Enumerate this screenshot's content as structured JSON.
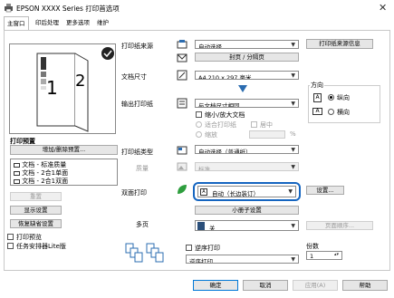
{
  "window": {
    "title": "EPSON XXXX Series 打印首选项",
    "close_glyph": "✕"
  },
  "tabs": [
    {
      "label": "主窗口"
    },
    {
      "label": "印后处理"
    },
    {
      "label": "更多选项"
    },
    {
      "label": "维护"
    }
  ],
  "left": {
    "preview_page": "1",
    "preview_page2": "2",
    "print_presets_label": "打印预置",
    "add_remove_presets": "增加/删除预置...",
    "presets": [
      "文档 - 标准质量",
      "文档 - 2合1单面",
      "文档 - 2合1双面"
    ],
    "show_settings": "显示设置",
    "reset": "重置",
    "restore_defaults": "恢复缺省设置",
    "print_preview_label": "打印预览",
    "job_arranger_label": "任务安排器Lite版"
  },
  "main": {
    "paper_source_label": "打印纸来源",
    "paper_source_value": "自动选择",
    "paper_source_info_btn": "打印纸来源信息",
    "envelope_btn": "封页 / 分隔页",
    "doc_size_label": "文档尺寸",
    "doc_size_value": "A4 210 x 297 毫米",
    "output_paper_label": "输出打印纸",
    "output_paper_value": "与文档尺寸相同",
    "reduce_enlarge_label": "缩小/放大文档",
    "fit_page_label": "适合打印纸",
    "center_label": "居中",
    "zoom_label": "缩放",
    "zoom_unit": "%",
    "orientation_label": "方向",
    "portrait_label": "纵向",
    "landscape_label": "横向",
    "paper_type_label": "打印纸类型",
    "paper_type_value": "自动选择（普通纸）",
    "quality_label": "质量",
    "quality_value": "标准",
    "duplex_label": "双面打印",
    "duplex_value": "自动（长边装订）",
    "duplex_settings_btn": "设置...",
    "booklet_btn": "小册子设置",
    "multipage_label": "多页",
    "multipage_value": "关",
    "page_order_btn": "页面顺序...",
    "reverse_order_label": "逆序打印",
    "copies_label": "份数",
    "copies_value": "1",
    "reverse_select_value": "逆序打印"
  },
  "footer": {
    "ok": "确定",
    "cancel": "取消",
    "apply": "应用(A)",
    "help": "帮助"
  },
  "colors": {
    "accent": "#1565c0",
    "panel_border": "#c8c8c8",
    "button_bg": "#e6e6e6"
  }
}
